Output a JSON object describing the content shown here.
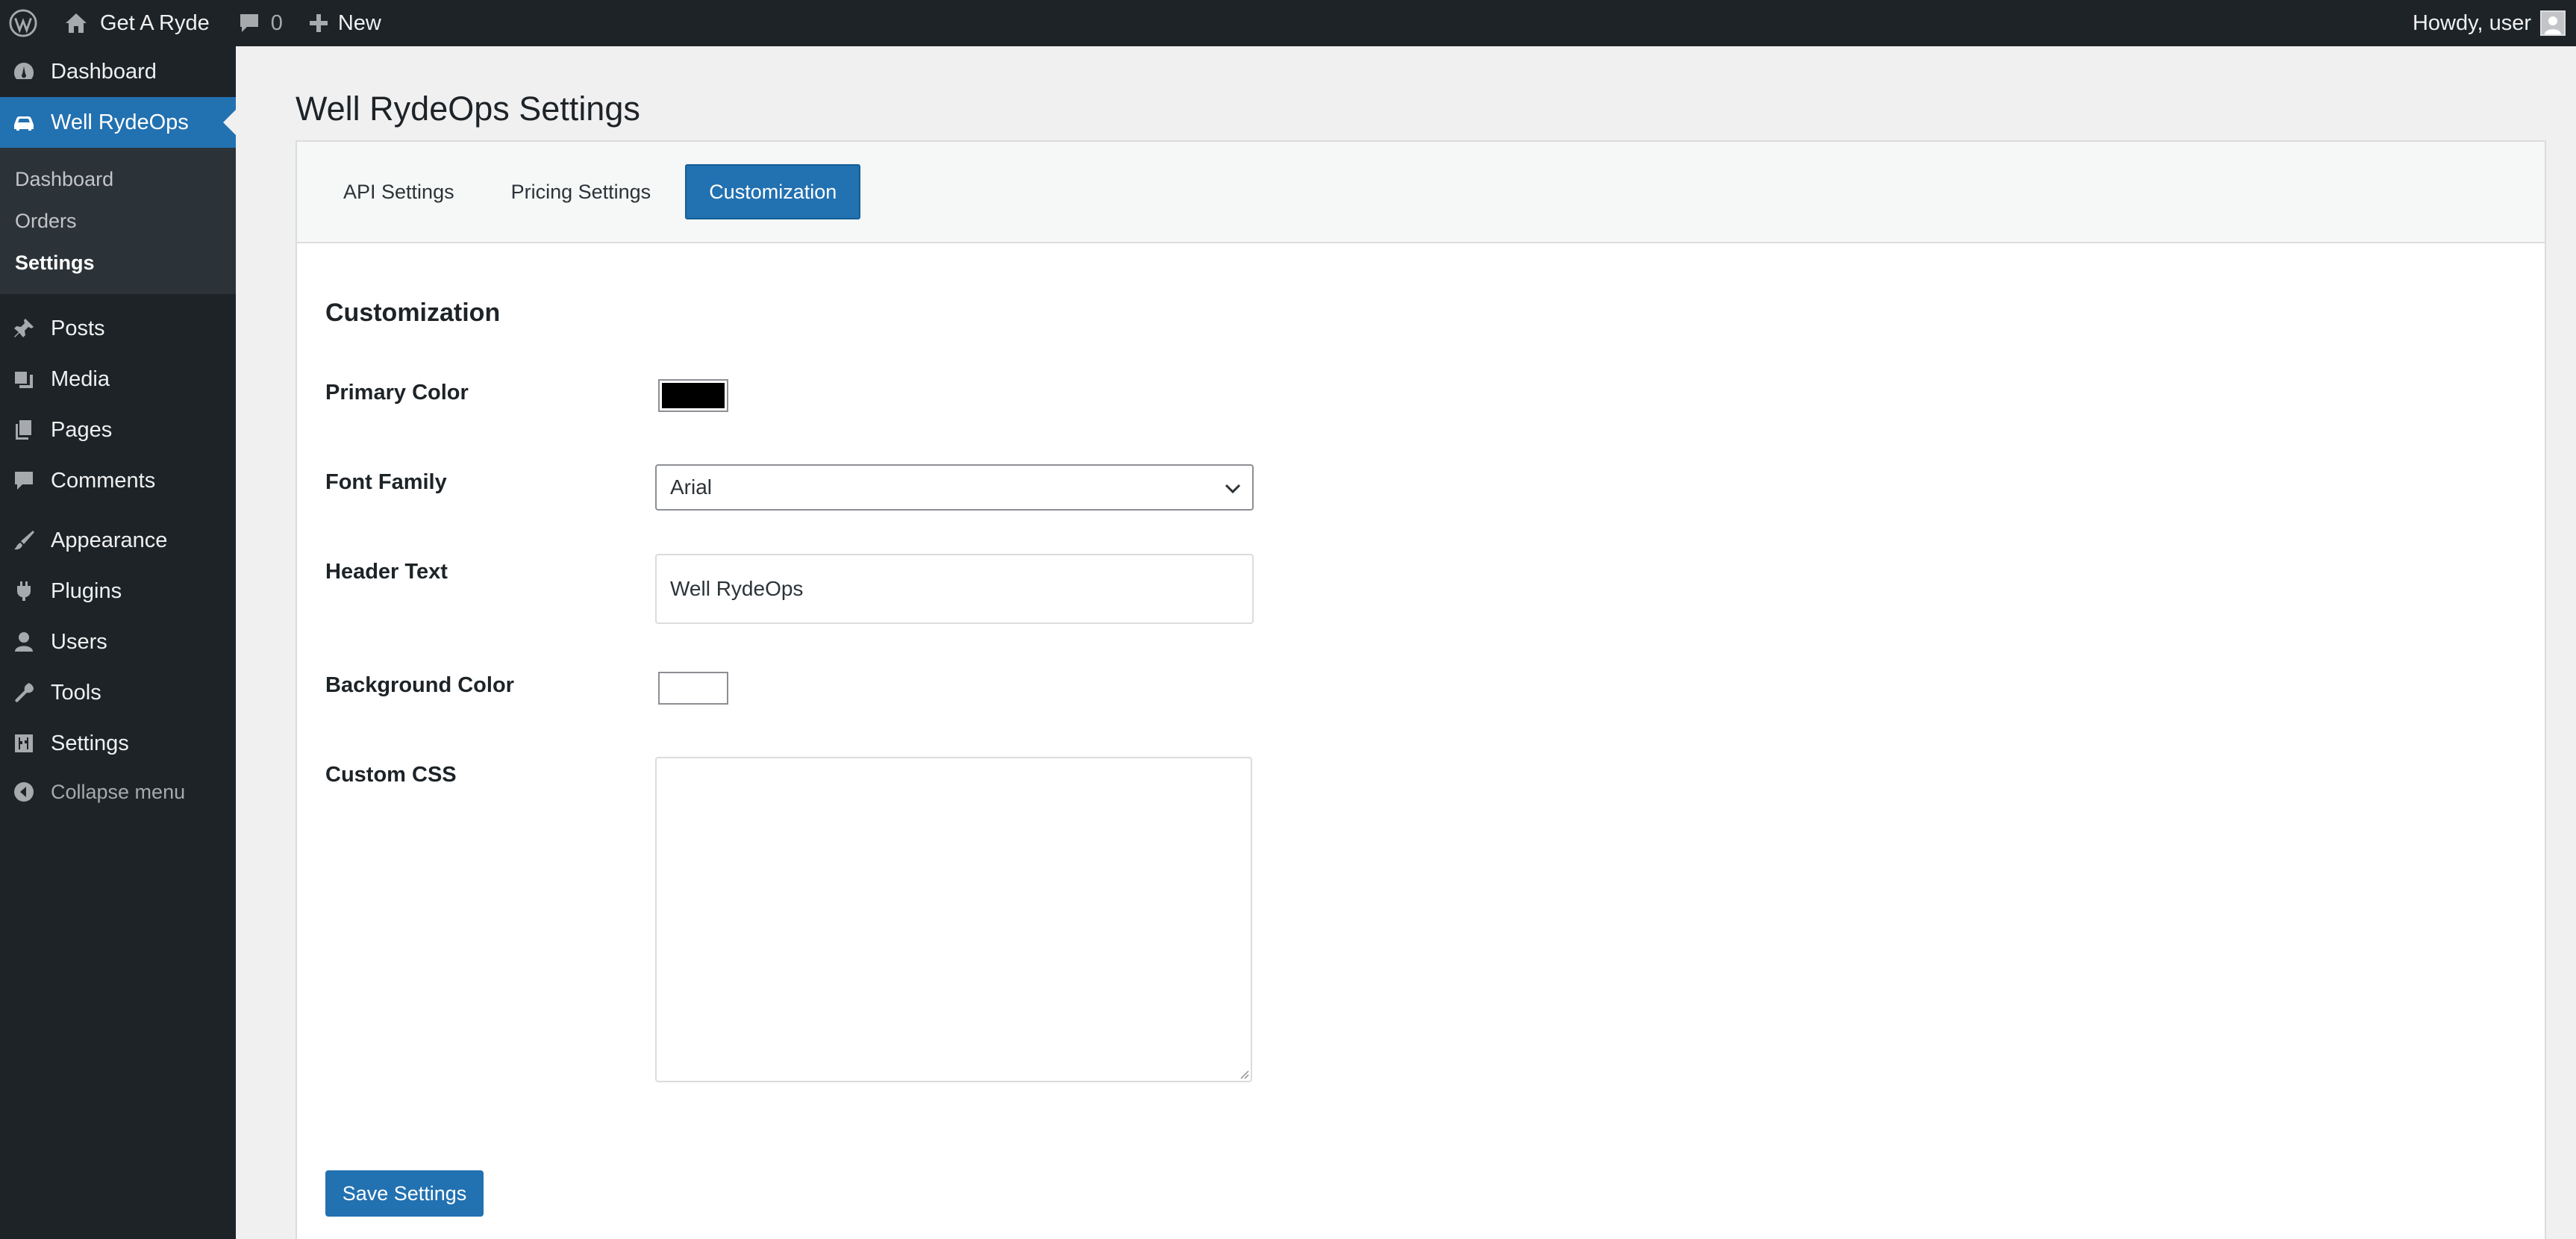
{
  "adminbar": {
    "site_name": "Get A Ryde",
    "comments_count": "0",
    "new_label": "New",
    "greeting": "Howdy, user"
  },
  "sidebar": {
    "top_item": "Dashboard",
    "current_item": "Well RydeOps",
    "submenu": [
      "Dashboard",
      "Orders",
      "Settings"
    ],
    "items": [
      "Posts",
      "Media",
      "Pages",
      "Comments",
      "Appearance",
      "Plugins",
      "Users",
      "Tools",
      "Settings"
    ],
    "collapse_label": "Collapse menu"
  },
  "page": {
    "title": "Well RydeOps Settings",
    "tabs": [
      "API Settings",
      "Pricing Settings",
      "Customization"
    ],
    "active_tab": "Customization",
    "section_title": "Customization",
    "fields": {
      "primary_color_label": "Primary Color",
      "primary_color_value": "#000000",
      "font_family_label": "Font Family",
      "font_family_value": "Arial",
      "header_text_label": "Header Text",
      "header_text_value": "Well RydeOps",
      "background_color_label": "Background Color",
      "background_color_value": "#ffffff",
      "custom_css_label": "Custom CSS",
      "custom_css_value": ""
    },
    "save_label": "Save Settings"
  },
  "colors": {
    "accent": "#2271b1",
    "sidebar_bg": "#1d2327"
  }
}
